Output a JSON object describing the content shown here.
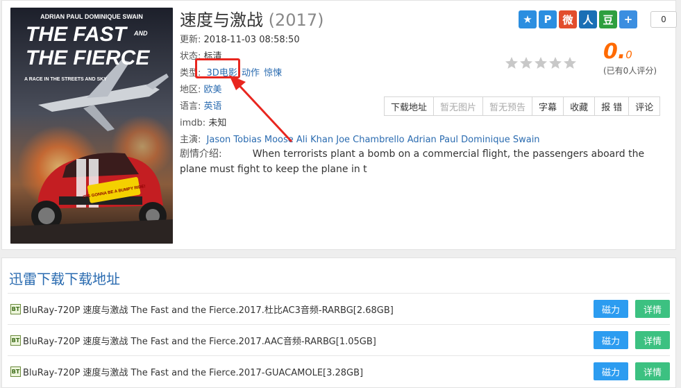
{
  "movie": {
    "title": "速度与激战",
    "year": "(2017)",
    "fields": {
      "updated_label": "更新:",
      "updated": "2018-11-03 08:58:50",
      "status_label": "状态:",
      "status": "标清",
      "genre_label": "类型:",
      "genres": [
        "3D电影",
        "动作",
        "惊悚"
      ],
      "region_label": "地区:",
      "region": "欧美",
      "language_label": "语言:",
      "language": "英语",
      "imdb_label": "imdb:",
      "imdb": "未知",
      "cast_label": "主演:",
      "cast": "Jason Tobias Moose Ali Khan Joe Chambrello Adrian Paul Dominique Swain",
      "plot_label": "剧情介绍:",
      "plot": "When terrorists plant a bomb on a commercial flight, the passengers aboard the plane must fight to keep the plane in t"
    },
    "poster": {
      "top_names": "ADRIAN PAUL    DOMINIQUE SWAIN",
      "logo_line1": "THE FAST",
      "logo_and": "AND",
      "logo_line2": "THE FIERCE",
      "tagline": "A RACE IN THE STREETS AND SKY",
      "sticker": "IT'S GONNA BE A BUMPY RIDE!"
    }
  },
  "share": {
    "icons": [
      {
        "name": "qzone-icon",
        "glyph": "★",
        "color": "#2b8ee0"
      },
      {
        "name": "tencent-weibo-icon",
        "glyph": "P",
        "color": "#2b8ee0"
      },
      {
        "name": "sina-weibo-icon",
        "glyph": "微",
        "color": "#e24d2c"
      },
      {
        "name": "renren-icon",
        "glyph": "人",
        "color": "#1a6fb5"
      },
      {
        "name": "douban-icon",
        "glyph": "豆",
        "color": "#2e9f3f"
      },
      {
        "name": "more-share-icon",
        "glyph": "+",
        "color": "#3b8ee0"
      }
    ],
    "count": "0"
  },
  "rating": {
    "score_int": "0.",
    "score_dec": "0",
    "note": "(已有0人评分)",
    "stars": 5
  },
  "actions": [
    "下载地址",
    "暂无图片",
    "暂无预告",
    "字幕",
    "收藏",
    "报 错",
    "评论"
  ],
  "disabled_actions": [
    "暂无图片",
    "暂无预告"
  ],
  "downloads": {
    "title": "迅雷下载下载地址",
    "bt_label": "BT",
    "magnet_label": "磁力",
    "detail_label": "详情",
    "items": [
      "BluRay-720P 速度与激战 The Fast and the Fierce.2017.杜比AC3音频-RARBG[2.68GB]",
      "BluRay-720P 速度与激战 The Fast and the Fierce.2017.AAC音频-RARBG[1.05GB]",
      "BluRay-720P 速度与激战 The Fast and the Fierce.2017-GUACAMOLE[3.28GB]"
    ]
  },
  "colors": {
    "link": "#2a6bb0",
    "magnet_button": "#2c9cf0",
    "detail_button": "#3cc181",
    "annotation": "#e8261f",
    "score": "#ff6a00"
  }
}
